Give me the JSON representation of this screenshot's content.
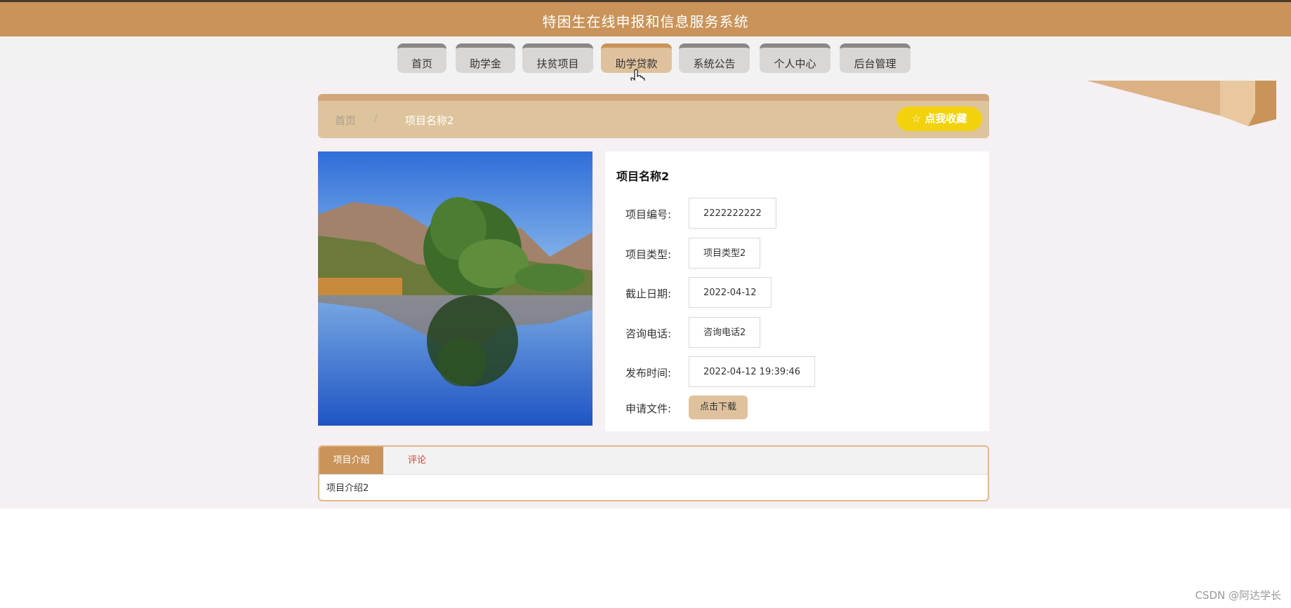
{
  "header": {
    "title": "特困生在线申报和信息服务系统"
  },
  "nav": {
    "items": [
      {
        "label": "首页"
      },
      {
        "label": "助学金"
      },
      {
        "label": "扶贫项目"
      },
      {
        "label": "助学贷款"
      },
      {
        "label": "系统公告"
      },
      {
        "label": "个人中心"
      },
      {
        "label": "后台管理"
      }
    ],
    "active_label": "助学贷款"
  },
  "breadcrumb": {
    "home": "首页",
    "separator": "/",
    "current": "项目名称2"
  },
  "favorite_button": {
    "label": "☆ 点我收藏",
    "icon": "star-outline-icon"
  },
  "detail": {
    "title": "项目名称2",
    "fields": [
      {
        "label": "项目编号:",
        "value": "2222222222"
      },
      {
        "label": "项目类型:",
        "value": "项目类型2"
      },
      {
        "label": "截止日期:",
        "value": "2022-04-12"
      },
      {
        "label": "咨询电话:",
        "value": "咨询电话2"
      },
      {
        "label": "发布时间:",
        "value": "2022-04-12 19:39:46"
      }
    ],
    "file": {
      "label": "申请文件:",
      "button": "点击下载"
    }
  },
  "tabs": {
    "items": [
      {
        "label": "项目介绍"
      },
      {
        "label": "评论"
      }
    ],
    "content": "项目介绍2"
  },
  "watermark": "CSDN @阿达学长",
  "colors": {
    "brand": "#c99359",
    "nav_active": "#dfc29d",
    "favorite": "#f2d20c",
    "comment_tab": "#e33a3a"
  }
}
